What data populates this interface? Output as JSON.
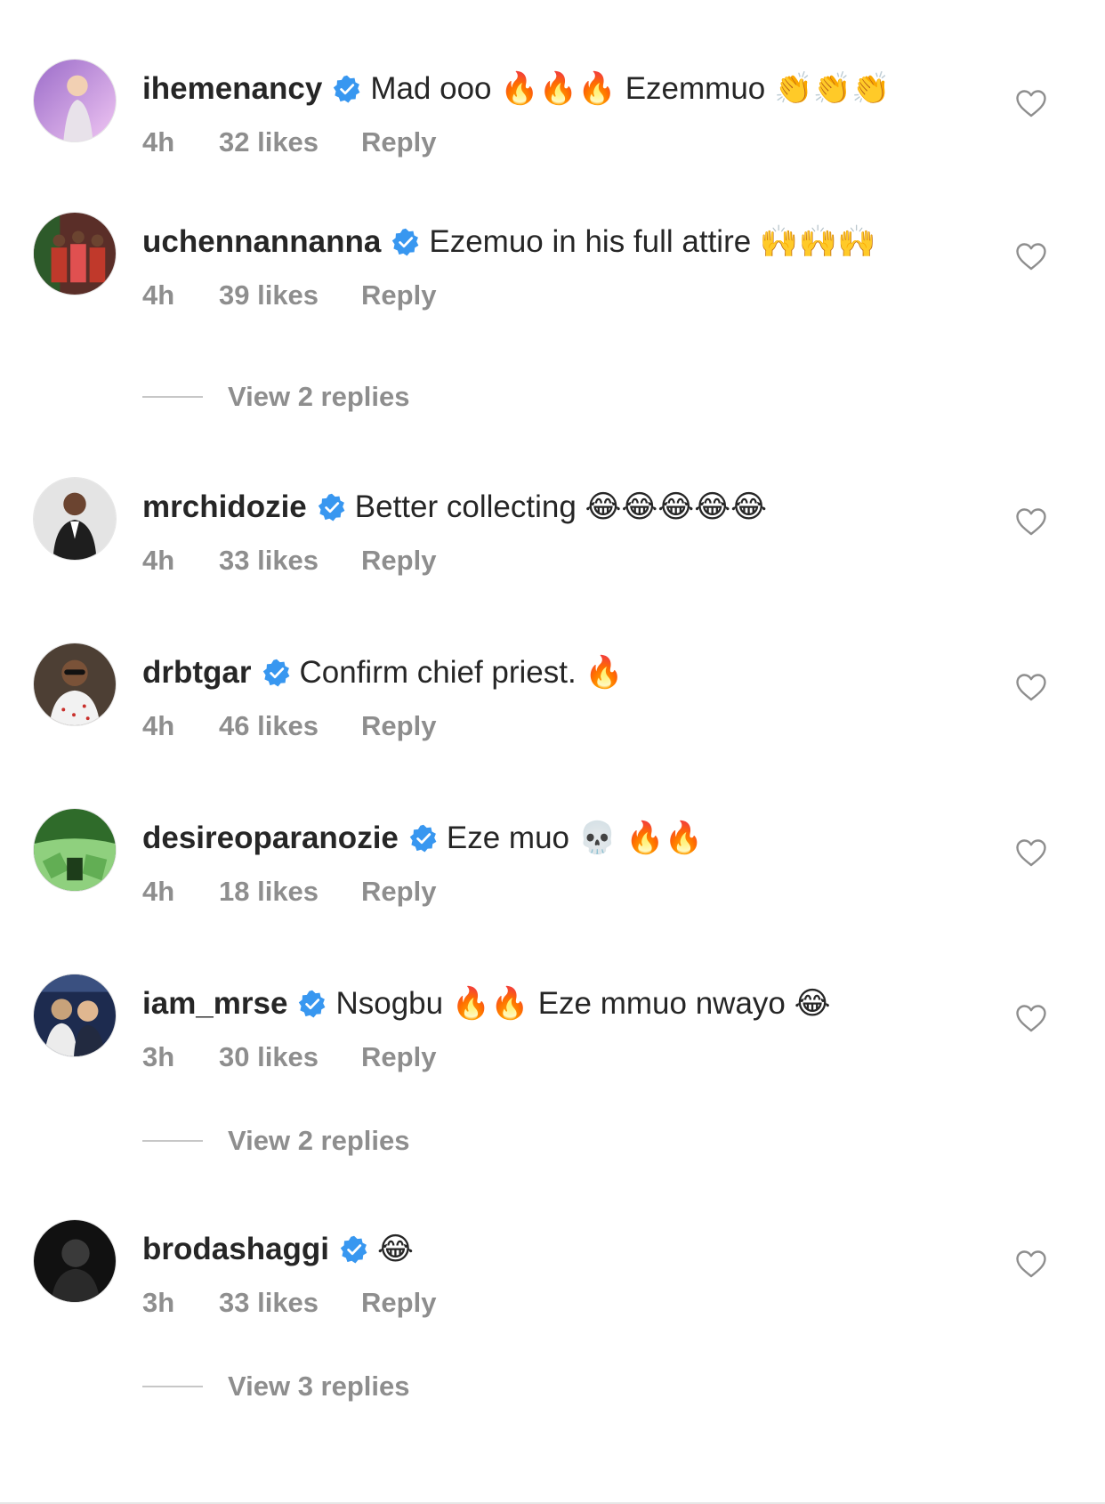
{
  "comments": [
    {
      "username": "ihemenancy",
      "text": "Mad ooo 🔥🔥🔥 Ezemmuo 👏👏👏",
      "time": "4h",
      "likes": "32 likes",
      "reply": "Reply",
      "avatar_colors": [
        "#b58bd8",
        "#e9b9f0"
      ]
    },
    {
      "username": "uchennannanna",
      "text": "Ezemuo in his full attire 🙌🙌🙌",
      "time": "4h",
      "likes": "39 likes",
      "reply": "Reply",
      "avatar_colors": [
        "#c0392b",
        "#6b2a22"
      ]
    },
    {
      "username": "mrchidozie",
      "text": "Better collecting 😂😂😂😂😂",
      "time": "4h",
      "likes": "33 likes",
      "reply": "Reply",
      "avatar_colors": [
        "#d8d8d8",
        "#1e1e1e"
      ]
    },
    {
      "username": "drbtgar",
      "text": "Confirm chief priest. 🔥",
      "time": "4h",
      "likes": "46 likes",
      "reply": "Reply",
      "avatar_colors": [
        "#5a4a3c",
        "#c9302c"
      ]
    },
    {
      "username": "desireoparanozie",
      "text": "Eze muo 💀 🔥🔥",
      "time": "4h",
      "likes": "18 likes",
      "reply": "Reply",
      "avatar_colors": [
        "#6fbf5e",
        "#2f6b2a"
      ]
    },
    {
      "username": "iam_mrse",
      "text": "Nsogbu 🔥🔥 Eze mmuo nwayo 😂",
      "time": "3h",
      "likes": "30 likes",
      "reply": "Reply",
      "avatar_colors": [
        "#1d2b4f",
        "#c8a27a"
      ]
    },
    {
      "username": "brodashaggi",
      "text": "😂",
      "time": "3h",
      "likes": "33 likes",
      "reply": "Reply",
      "avatar_colors": [
        "#111111",
        "#444444"
      ]
    }
  ],
  "view_replies": [
    {
      "label": "View 2 replies"
    },
    {
      "label": "View 2 replies"
    },
    {
      "label": "View 3 replies"
    }
  ],
  "colors": {
    "text": "#262626",
    "muted": "#8e8e8e",
    "verified": "#3897f0",
    "divider": "#c7c7c7"
  },
  "icons": {
    "verified": "verified-badge-icon",
    "like": "heart-outline-icon"
  }
}
